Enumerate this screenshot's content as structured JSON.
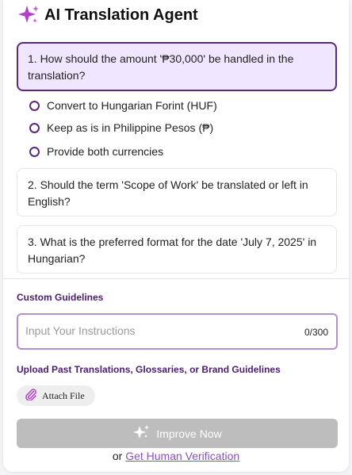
{
  "header": {
    "title": "AI Translation Agent",
    "icon": "sparkle-icon"
  },
  "questions": [
    {
      "text": "1. How should the amount '₱30,000' be handled in the translation?",
      "selected": true,
      "options": [
        "Convert to Hungarian Forint (HUF)",
        "Keep as is in Philippine Pesos (₱)",
        "Provide both currencies"
      ]
    },
    {
      "text": "2. Should the term 'Scope of Work' be translated or left in English?"
    },
    {
      "text": "3. What is the preferred format for the date 'July 7, 2025' in Hungarian?"
    }
  ],
  "guidelines": {
    "label": "Custom Guidelines",
    "placeholder": "Input Your Instructions",
    "value": "",
    "counter": "0/300"
  },
  "upload": {
    "label": "Upload Past Translations, Glossaries, or Brand Guidelines",
    "attach_label": "Attach File",
    "icon": "paperclip-icon"
  },
  "improve_button": {
    "label": "Improve Now",
    "icon": "sparkle-icon"
  },
  "footer": {
    "prefix": "or",
    "link": "Get Human Verification"
  },
  "colors": {
    "accent": "#5a2a78",
    "selected_card_bg": "#f1e6ff",
    "sparkle": "#b43fc9",
    "link": "#8a4fc4",
    "disabled_button": "#bdbdbd"
  }
}
